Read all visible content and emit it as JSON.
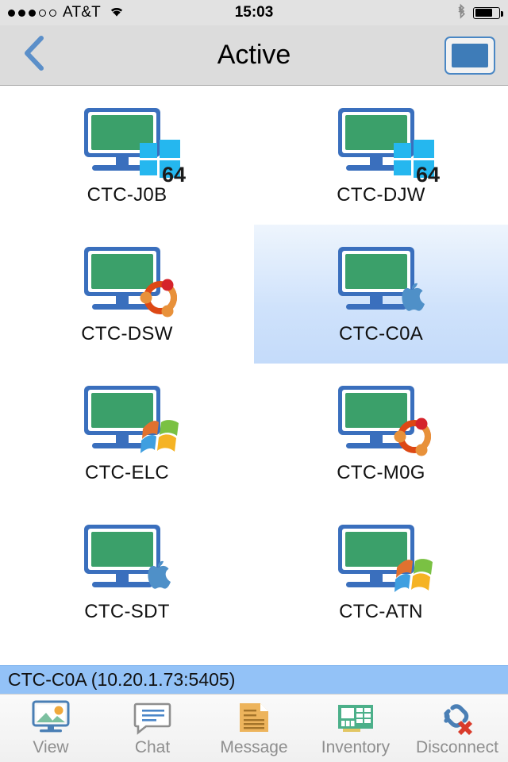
{
  "status_bar": {
    "signal_dots_filled": 3,
    "signal_dots_total": 5,
    "carrier": "AT&T",
    "wifi_icon": "wifi-icon",
    "time": "15:03",
    "bluetooth_icon": "bluetooth-icon",
    "battery_icon": "battery-icon",
    "battery_level_percent": 68
  },
  "nav_bar": {
    "back_icon": "chevron-left-icon",
    "title": "Active",
    "right_button_icon": "screen-view-icon"
  },
  "hosts": [
    {
      "name": "CTC-J0B",
      "os": "windows8",
      "badge": "64",
      "selected": false
    },
    {
      "name": "CTC-DJW",
      "os": "windows8",
      "badge": "64",
      "selected": false
    },
    {
      "name": "CTC-DSW",
      "os": "ubuntu",
      "badge": "",
      "selected": false
    },
    {
      "name": "CTC-C0A",
      "os": "apple",
      "badge": "",
      "selected": true
    },
    {
      "name": "CTC-ELC",
      "os": "windows7",
      "badge": "",
      "selected": false
    },
    {
      "name": "CTC-M0G",
      "os": "ubuntu",
      "badge": "",
      "selected": false
    },
    {
      "name": "CTC-SDT",
      "os": "apple",
      "badge": "",
      "selected": false
    },
    {
      "name": "CTC-ATN",
      "os": "windows7",
      "badge": "",
      "selected": false
    }
  ],
  "info_bar": {
    "text": "CTC-C0A (10.20.1.73:5405)"
  },
  "toolbar": {
    "items": [
      {
        "label": "View",
        "icon": "monitor-picture-icon"
      },
      {
        "label": "Chat",
        "icon": "chat-bubble-icon"
      },
      {
        "label": "Message",
        "icon": "document-icon"
      },
      {
        "label": "Inventory",
        "icon": "circuit-board-icon"
      },
      {
        "label": "Disconnect",
        "icon": "broken-link-icon"
      }
    ]
  },
  "colors": {
    "monitor_frame": "#3a6fbd",
    "monitor_screen": "#3ba06a",
    "selection_blue": "#cfe2fb",
    "infobar_blue": "#93c2f7",
    "navbar_gray": "#dcdcdc",
    "statusbar_gray": "#e2e2e2",
    "toolbar_label": "#8e8e8e"
  }
}
